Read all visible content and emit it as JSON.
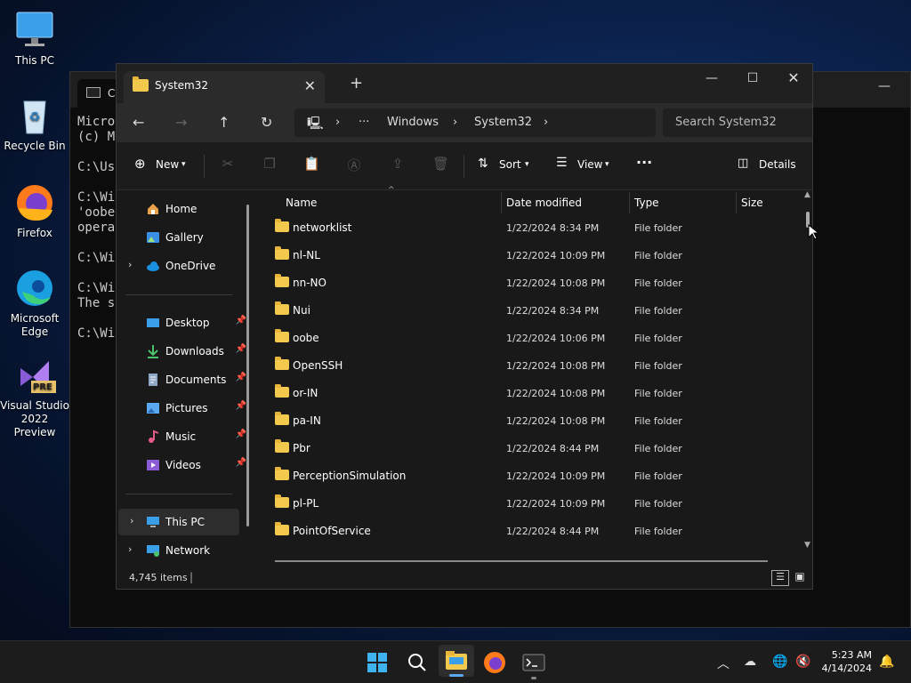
{
  "desktop": {
    "icons": [
      {
        "label": "This PC"
      },
      {
        "label": "Recycle Bin"
      },
      {
        "label": "Firefox"
      },
      {
        "label": "Microsoft Edge"
      },
      {
        "label": "Visual Studio 2022 Preview",
        "badge": "PRE"
      }
    ]
  },
  "cmd": {
    "tab_title": "Co",
    "lines": "Micro\n(c) M\n\nC:\\Us\n\nC:\\Wi\n'oobe\noperа\n\nC:\\Wi\n\nC:\\Wi\nThe s\n\nC:\\Wi"
  },
  "explorer": {
    "tab_title": "System32",
    "breadcrumb": [
      "Windows",
      "System32"
    ],
    "search_placeholder": "Search System32",
    "toolbar": {
      "new": "New",
      "sort": "Sort",
      "view": "View",
      "details": "Details"
    },
    "sidebar": {
      "home": "Home",
      "gallery": "Gallery",
      "onedrive": "OneDrive",
      "desktop": "Desktop",
      "downloads": "Downloads",
      "documents": "Documents",
      "pictures": "Pictures",
      "music": "Music",
      "videos": "Videos",
      "thispc": "This PC",
      "network": "Network"
    },
    "columns": {
      "name": "Name",
      "date": "Date modified",
      "type": "Type",
      "size": "Size"
    },
    "rows": [
      {
        "name": "networklist",
        "date": "1/22/2024 8:34 PM",
        "type": "File folder"
      },
      {
        "name": "nl-NL",
        "date": "1/22/2024 10:09 PM",
        "type": "File folder"
      },
      {
        "name": "nn-NO",
        "date": "1/22/2024 10:08 PM",
        "type": "File folder"
      },
      {
        "name": "Nui",
        "date": "1/22/2024 8:34 PM",
        "type": "File folder"
      },
      {
        "name": "oobe",
        "date": "1/22/2024 10:06 PM",
        "type": "File folder"
      },
      {
        "name": "OpenSSH",
        "date": "1/22/2024 10:08 PM",
        "type": "File folder"
      },
      {
        "name": "or-IN",
        "date": "1/22/2024 10:08 PM",
        "type": "File folder"
      },
      {
        "name": "pa-IN",
        "date": "1/22/2024 10:08 PM",
        "type": "File folder"
      },
      {
        "name": "Pbr",
        "date": "1/22/2024 8:44 PM",
        "type": "File folder"
      },
      {
        "name": "PerceptionSimulation",
        "date": "1/22/2024 10:09 PM",
        "type": "File folder"
      },
      {
        "name": "pl-PL",
        "date": "1/22/2024 10:09 PM",
        "type": "File folder"
      },
      {
        "name": "PointOfService",
        "date": "1/22/2024 8:44 PM",
        "type": "File folder"
      }
    ],
    "status": "4,745 items"
  },
  "taskbar": {
    "time": "5:23 AM",
    "date": "4/14/2024"
  },
  "colors": {
    "accent": "#0078d4",
    "folder": "#f2c94c"
  }
}
